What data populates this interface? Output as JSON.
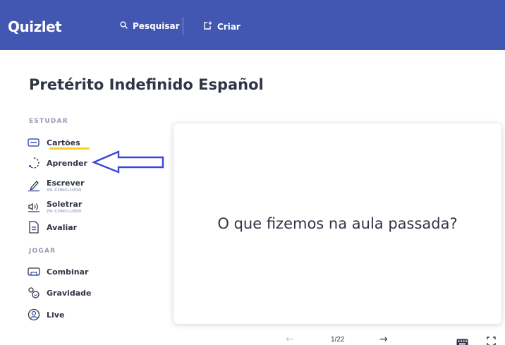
{
  "header": {
    "logo": "Quizlet",
    "search_label": "Pesquisar",
    "create_label": "Criar"
  },
  "set": {
    "title": "Pretérito Indefinido Español"
  },
  "sidebar": {
    "study_heading": "ESTUDAR",
    "study_items": [
      {
        "label": "Cartões",
        "icon": "cards-icon"
      },
      {
        "label": "Aprender",
        "icon": "learn-icon"
      },
      {
        "label": "Escrever",
        "sub": "3% CONCLUÍDO",
        "icon": "write-icon"
      },
      {
        "label": "Soletrar",
        "sub": "2% CONCLUÍDO",
        "icon": "spell-icon"
      },
      {
        "label": "Avaliar",
        "icon": "test-icon"
      }
    ],
    "play_heading": "JOGAR",
    "play_items": [
      {
        "label": "Combinar",
        "icon": "match-icon"
      },
      {
        "label": "Gravidade",
        "icon": "gravity-icon"
      },
      {
        "label": "Live",
        "icon": "live-icon"
      }
    ]
  },
  "flashcard": {
    "front_text": "O que fizemos na aula passada?",
    "position": "1/22"
  },
  "colors": {
    "header_bg": "#4257b2",
    "active_underline": "#ffcd1f",
    "icon_blue": "#4257b2",
    "annotation_arrow": "#3b47d9"
  }
}
